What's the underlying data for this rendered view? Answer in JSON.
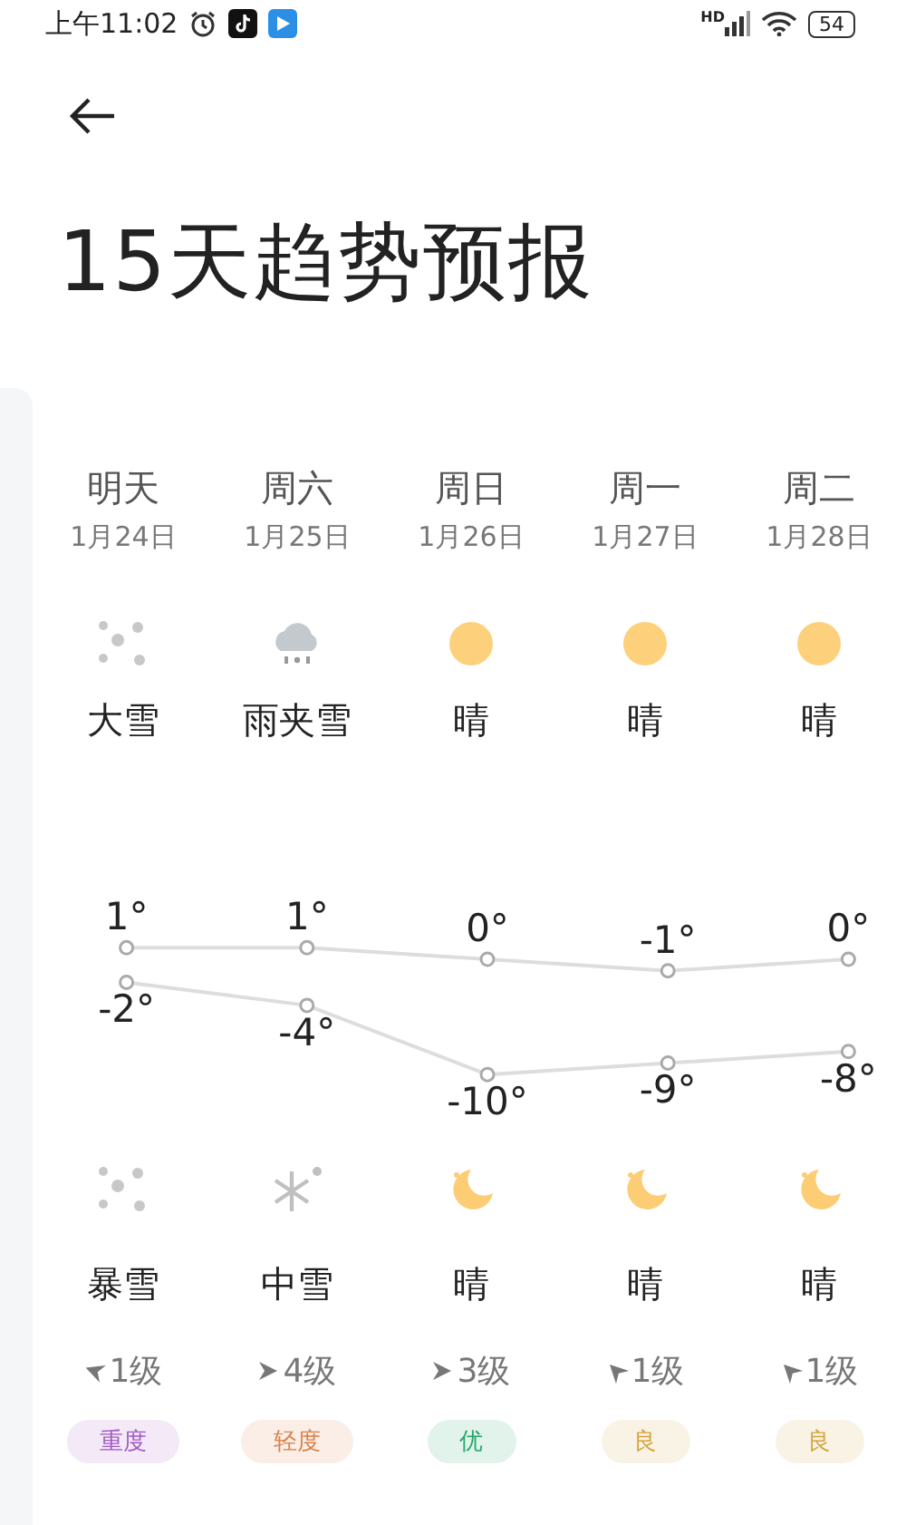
{
  "status_bar": {
    "time": "上午11:02",
    "signal_label": "HD",
    "battery": "54"
  },
  "title": "15天趋势预报",
  "days": [
    {
      "name": "明天",
      "date": "1月24日",
      "day": {
        "kind": "snow",
        "weather": "大雪"
      },
      "night": {
        "kind": "snow",
        "weather": "暴雪"
      },
      "wind": {
        "kind": "west",
        "text": "1级"
      },
      "aqi": "重度",
      "color": "#a25bc4"
    },
    {
      "name": "周六",
      "date": "1月25日",
      "day": {
        "kind": "sleet",
        "weather": "雨夹雪"
      },
      "night": {
        "kind": "snowflake",
        "weather": "中雪"
      },
      "wind": {
        "kind": "east",
        "text": "4级"
      },
      "aqi": "轻度",
      "color": "#d9824a"
    },
    {
      "name": "周日",
      "date": "1月26日",
      "day": {
        "kind": "sun",
        "weather": "晴"
      },
      "night": {
        "kind": "moon",
        "weather": "晴"
      },
      "wind": {
        "kind": "east",
        "text": "3级"
      },
      "aqi": "优",
      "color": "#25a86a"
    },
    {
      "name": "周一",
      "date": "1月27日",
      "day": {
        "kind": "sun",
        "weather": "晴"
      },
      "night": {
        "kind": "moon",
        "weather": "晴"
      },
      "wind": {
        "kind": "northwest",
        "text": "1级"
      },
      "aqi": "良",
      "color": "#d4a43a"
    },
    {
      "name": "周二",
      "date": "1月28日",
      "day": {
        "kind": "sun",
        "weather": "晴"
      },
      "night": {
        "kind": "moon",
        "weather": "晴"
      },
      "wind": {
        "kind": "northwest",
        "text": "1级"
      },
      "aqi": "良",
      "color": "#d4a43a"
    }
  ],
  "chart_data": {
    "type": "line",
    "data_labels": true,
    "series": [
      {
        "color": "#dddddd",
        "marker": "circle",
        "values": [
          1,
          1,
          0,
          -1,
          0
        ],
        "value_labels": [
          "1°",
          "1°",
          "0°",
          "-1°",
          "0°"
        ]
      },
      {
        "color": "#dddddd",
        "marker": "circle",
        "values": [
          -2,
          -4,
          -10,
          -9,
          -8
        ],
        "value_labels": [
          "-2°",
          "-4°",
          "-10°",
          "-9°",
          "-8°"
        ]
      }
    ]
  }
}
